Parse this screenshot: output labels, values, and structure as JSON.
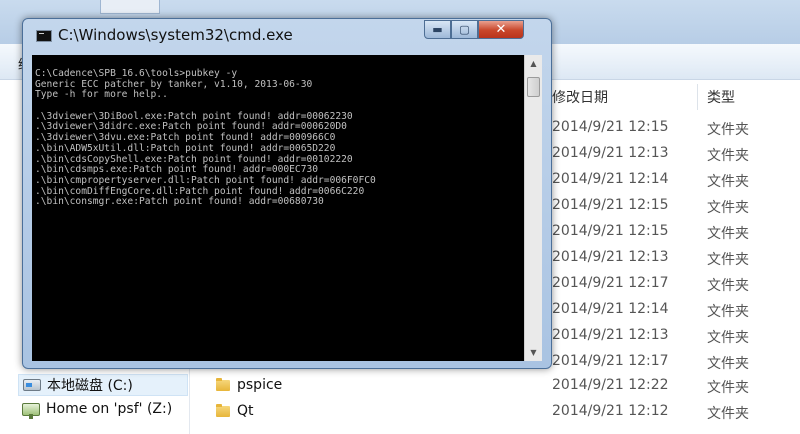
{
  "window": {
    "title": "C:\\Windows\\system32\\cmd.exe",
    "min_glyph": "▬",
    "max_glyph": "▢",
    "close_glyph": "✕"
  },
  "console": {
    "lines": [
      "C:\\Cadence\\SPB_16.6\\tools>pubkey -y",
      "Generic ECC patcher by tanker, v1.10, 2013-06-30",
      "Type -h for more help..",
      "",
      ".\\3dviewer\\3DiBool.exe:Patch point found! addr=00062230",
      ".\\3dviewer\\3didrc.exe:Patch point found! addr=000620D0",
      ".\\3dviewer\\3dvu.exe:Patch point found! addr=000966C0",
      ".\\bin\\ADW5xUtil.dll:Patch point found! addr=0065D220",
      ".\\bin\\cdsCopyShell.exe:Patch point found! addr=00102220",
      ".\\bin\\cdsmps.exe:Patch point found! addr=000EC730",
      ".\\bin\\cmpropertyserver.dll:Patch point found! addr=006F0FC0",
      ".\\bin\\comDiffEngCore.dll:Patch point found! addr=0066C220",
      ".\\bin\\consmgr.exe:Patch point found! addr=00680730"
    ]
  },
  "toolbar": {
    "partial_char": "给"
  },
  "explorer": {
    "columns": {
      "date": "修改日期",
      "type": "类型"
    },
    "rows": [
      {
        "name": "",
        "date": "2014/9/21 12:15",
        "type": "文件夹"
      },
      {
        "name": "",
        "date": "2014/9/21 12:13",
        "type": "文件夹"
      },
      {
        "name": "",
        "date": "2014/9/21 12:14",
        "type": "文件夹"
      },
      {
        "name": "",
        "date": "2014/9/21 12:15",
        "type": "文件夹"
      },
      {
        "name": "",
        "date": "2014/9/21 12:15",
        "type": "文件夹"
      },
      {
        "name": "",
        "date": "2014/9/21 12:13",
        "type": "文件夹"
      },
      {
        "name": "",
        "date": "2014/9/21 12:17",
        "type": "文件夹"
      },
      {
        "name": "",
        "date": "2014/9/21 12:14",
        "type": "文件夹"
      },
      {
        "name": "",
        "date": "2014/9/21 12:13",
        "type": "文件夹"
      },
      {
        "name": "",
        "date": "2014/9/21 12:17",
        "type": "文件夹"
      },
      {
        "name": "pspice",
        "date": "2014/9/21 12:22",
        "type": "文件夹"
      },
      {
        "name": "Qt",
        "date": "2014/9/21 12:12",
        "type": "文件夹"
      }
    ]
  },
  "nav": {
    "items": [
      {
        "label": "本地磁盘 (C:)",
        "icon": "drive-icon"
      },
      {
        "label": "Home on 'psf' (Z:)",
        "icon": "network-drive-icon"
      }
    ]
  },
  "colors": {
    "console_bg": "#000000",
    "console_fg": "#c0c0c0",
    "titlebar": "#b7cde6"
  }
}
